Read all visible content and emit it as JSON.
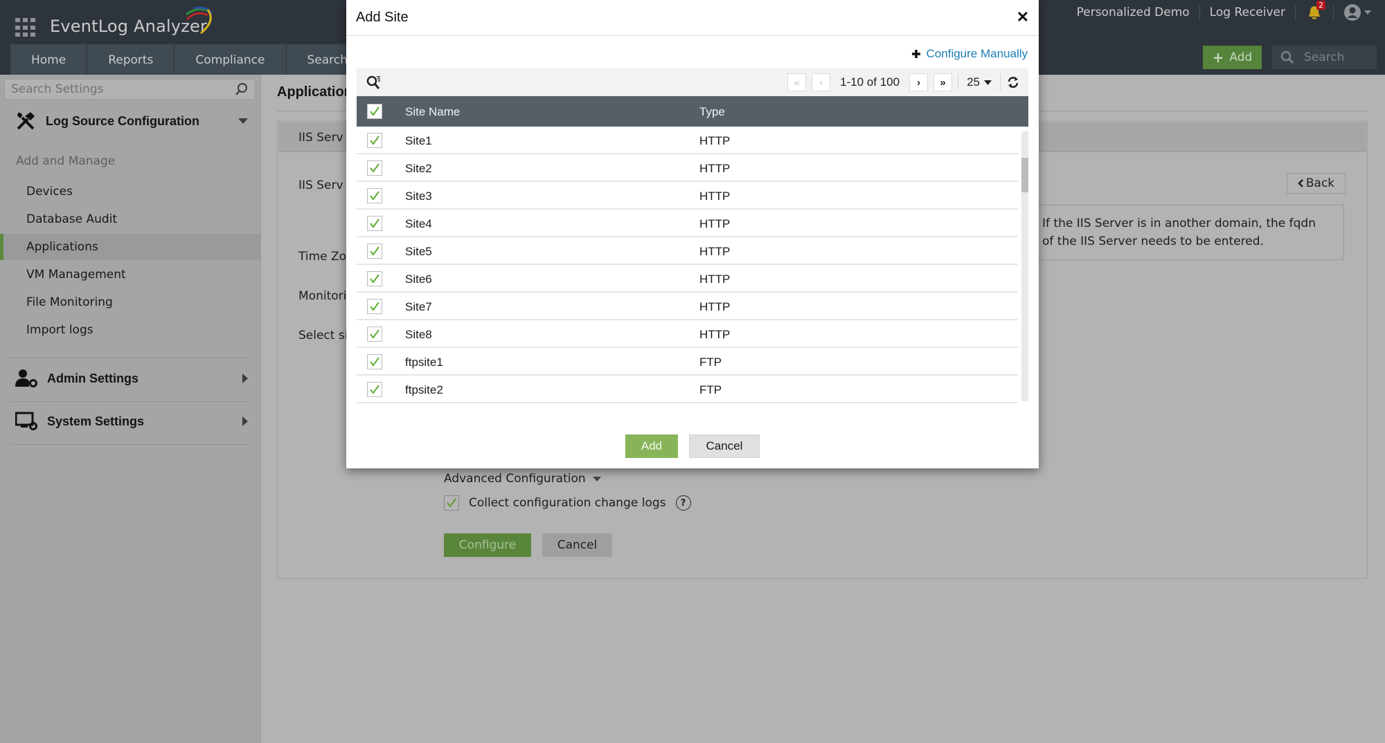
{
  "header": {
    "brand": "EventLog Analyzer",
    "top_links": [
      "Personalized Demo",
      "Log Receiver"
    ],
    "notification_count": "2",
    "nav_tabs": [
      "Home",
      "Reports",
      "Compliance",
      "Search"
    ],
    "add_label": "Add",
    "search_placeholder": "Search"
  },
  "sidebar": {
    "search_placeholder": "Search Settings",
    "sections": [
      {
        "label": "Log Source Configuration",
        "icon": "tools-icon",
        "expanded": true
      },
      {
        "label": "Admin Settings",
        "icon": "user-gear-icon",
        "expanded": false
      },
      {
        "label": "System Settings",
        "icon": "monitor-gear-icon",
        "expanded": false
      }
    ],
    "subheading": "Add and Manage",
    "items": [
      {
        "label": "Devices",
        "active": false
      },
      {
        "label": "Database Audit",
        "active": false
      },
      {
        "label": "Applications",
        "active": true
      },
      {
        "label": "VM Management",
        "active": false
      },
      {
        "label": "File Monitoring",
        "active": false
      },
      {
        "label": "Import logs",
        "active": false
      }
    ]
  },
  "main": {
    "title": "Applications",
    "form_labels": [
      "IIS Serv",
      "IIS Serv",
      "Time Zo",
      "Monitori",
      "Select si"
    ],
    "back_label": "Back",
    "info_text_line1": "If the IIS Server is in another domain, the fqdn",
    "info_text_line2": "of the IIS Server needs to be entered.",
    "advanced_config_label": "Advanced Configuration",
    "collect_logs_label": "Collect configuration change logs",
    "collect_logs_checked": true,
    "configure_label": "Configure",
    "cancel_label": "Cancel"
  },
  "modal": {
    "title": "Add Site",
    "configure_manually": "Configure Manually",
    "pagination": {
      "range": "1-10 of 100",
      "page_size": "25"
    },
    "columns": [
      "Site Name",
      "Type"
    ],
    "select_all_checked": true,
    "rows": [
      {
        "name": "Site1",
        "type": "HTTP",
        "checked": true
      },
      {
        "name": "Site2",
        "type": "HTTP",
        "checked": true
      },
      {
        "name": "Site3",
        "type": "HTTP",
        "checked": true
      },
      {
        "name": "Site4",
        "type": "HTTP",
        "checked": true
      },
      {
        "name": "Site5",
        "type": "HTTP",
        "checked": true
      },
      {
        "name": "Site6",
        "type": "HTTP",
        "checked": true
      },
      {
        "name": "Site7",
        "type": "HTTP",
        "checked": true
      },
      {
        "name": "Site8",
        "type": "HTTP",
        "checked": true
      },
      {
        "name": "ftpsite1",
        "type": "FTP",
        "checked": true
      },
      {
        "name": "ftpsite2",
        "type": "FTP",
        "checked": true
      }
    ],
    "add_label": "Add",
    "cancel_label": "Cancel"
  },
  "colors": {
    "header_bg": "#2e343b",
    "accent_green": "#87b458",
    "link_blue": "#1a7fb5",
    "table_header": "#575f66",
    "badge_red": "#b3161b"
  }
}
